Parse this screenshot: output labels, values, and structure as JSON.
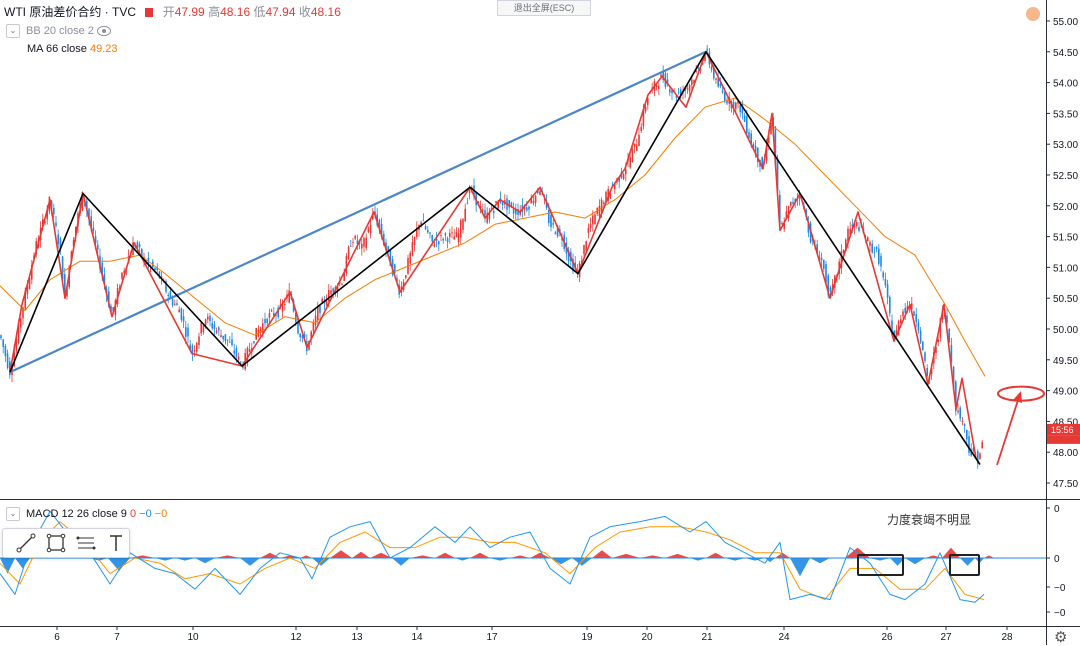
{
  "header": {
    "symbol": "WTI 原油差价合约 · TVC",
    "ohlc": [
      {
        "label": "开",
        "value": "47.99"
      },
      {
        "label": "高",
        "value": "48.16"
      },
      {
        "label": "低",
        "value": "47.94"
      },
      {
        "label": "收",
        "value": "48.16"
      }
    ],
    "esc_button": "退出全屏(ESC)"
  },
  "indicators": {
    "bb": "BB 20 close 2",
    "ma_label": "MA 66 close",
    "ma_value": "49.23",
    "macd_label": "MACD 12 26 close 9",
    "macd_values": [
      "0",
      "−0",
      "−0"
    ]
  },
  "annotation": "力度衰竭不明显",
  "colors": {
    "up": "#e53935",
    "down": "#1e88e5",
    "ma": "#f57c00",
    "trend_blue": "#4a86c8",
    "zigzag_black": "#000000",
    "zigzag_red": "#e53935",
    "macd_line": "#2196f3",
    "signal_line": "#ff9800"
  },
  "chart_data": [
    {
      "type": "line",
      "panel": "price",
      "ylim": [
        47.25,
        55.25
      ],
      "yticks": [
        "55.00",
        "54.50",
        "54.00",
        "53.50",
        "53.00",
        "52.50",
        "52.00",
        "51.50",
        "51.00",
        "50.50",
        "50.00",
        "49.50",
        "49.00",
        "48.50",
        "48.00",
        "47.50"
      ],
      "last_price_tag": "15:56",
      "x_labels": [
        {
          "label": "6",
          "t": 57
        },
        {
          "label": "7",
          "t": 117
        },
        {
          "label": "10",
          "t": 193
        },
        {
          "label": "12",
          "t": 296
        },
        {
          "label": "13",
          "t": 357
        },
        {
          "label": "14",
          "t": 417
        },
        {
          "label": "17",
          "t": 492
        },
        {
          "label": "19",
          "t": 587
        },
        {
          "label": "20",
          "t": 647
        },
        {
          "label": "21",
          "t": 707
        },
        {
          "label": "24",
          "t": 784
        },
        {
          "label": "26",
          "t": 887
        },
        {
          "label": "27",
          "t": 946
        },
        {
          "label": "28",
          "t": 1007
        }
      ],
      "price_path": [
        [
          0,
          49.9
        ],
        [
          10,
          49.3
        ],
        [
          22,
          50.3
        ],
        [
          35,
          51.3
        ],
        [
          50,
          52.1
        ],
        [
          60,
          51.3
        ],
        [
          65,
          50.5
        ],
        [
          72,
          51.4
        ],
        [
          83,
          52.2
        ],
        [
          95,
          51.4
        ],
        [
          112,
          50.2
        ],
        [
          122,
          50.9
        ],
        [
          134,
          51.4
        ],
        [
          145,
          51.1
        ],
        [
          158,
          50.9
        ],
        [
          170,
          50.5
        ],
        [
          180,
          50.3
        ],
        [
          192,
          49.6
        ],
        [
          205,
          50.2
        ],
        [
          215,
          50.0
        ],
        [
          228,
          49.8
        ],
        [
          242,
          49.4
        ],
        [
          255,
          49.9
        ],
        [
          268,
          50.2
        ],
        [
          280,
          50.3
        ],
        [
          290,
          50.6
        ],
        [
          298,
          50.0
        ],
        [
          307,
          49.7
        ],
        [
          318,
          50.3
        ],
        [
          330,
          50.6
        ],
        [
          342,
          50.8
        ],
        [
          352,
          51.5
        ],
        [
          362,
          51.3
        ],
        [
          374,
          51.9
        ],
        [
          386,
          51.3
        ],
        [
          400,
          50.6
        ],
        [
          412,
          51.3
        ],
        [
          420,
          51.8
        ],
        [
          432,
          51.4
        ],
        [
          445,
          51.5
        ],
        [
          458,
          51.5
        ],
        [
          470,
          52.3
        ],
        [
          485,
          51.8
        ],
        [
          500,
          52.1
        ],
        [
          515,
          51.9
        ],
        [
          528,
          52.0
        ],
        [
          540,
          52.3
        ],
        [
          550,
          51.7
        ],
        [
          562,
          51.5
        ],
        [
          570,
          51.1
        ],
        [
          578,
          50.9
        ],
        [
          588,
          51.6
        ],
        [
          600,
          52.0
        ],
        [
          612,
          52.3
        ],
        [
          625,
          52.6
        ],
        [
          636,
          53.0
        ],
        [
          648,
          53.8
        ],
        [
          662,
          54.1
        ],
        [
          675,
          53.8
        ],
        [
          686,
          53.9
        ],
        [
          698,
          54.2
        ],
        [
          706,
          54.5
        ],
        [
          716,
          54.0
        ],
        [
          728,
          53.7
        ],
        [
          740,
          53.6
        ],
        [
          752,
          53.0
        ],
        [
          763,
          52.6
        ],
        [
          772,
          53.5
        ],
        [
          780,
          51.6
        ],
        [
          790,
          52.0
        ],
        [
          800,
          52.2
        ],
        [
          812,
          51.4
        ],
        [
          822,
          51.1
        ],
        [
          830,
          50.5
        ],
        [
          840,
          51.1
        ],
        [
          848,
          51.6
        ],
        [
          858,
          51.7
        ],
        [
          868,
          51.4
        ],
        [
          878,
          51.2
        ],
        [
          886,
          50.6
        ],
        [
          894,
          49.8
        ],
        [
          902,
          50.3
        ],
        [
          910,
          50.4
        ],
        [
          918,
          50.1
        ],
        [
          928,
          49.1
        ],
        [
          938,
          49.9
        ],
        [
          944,
          50.4
        ],
        [
          950,
          49.7
        ],
        [
          956,
          48.7
        ],
        [
          963,
          48.5
        ],
        [
          970,
          48.0
        ],
        [
          978,
          47.9
        ],
        [
          984,
          48.2
        ]
      ],
      "ma_path": [
        [
          0,
          50.7
        ],
        [
          25,
          50.3
        ],
        [
          50,
          50.8
        ],
        [
          80,
          51.1
        ],
        [
          110,
          51.1
        ],
        [
          140,
          51.2
        ],
        [
          165,
          50.9
        ],
        [
          195,
          50.5
        ],
        [
          225,
          50.1
        ],
        [
          255,
          49.9
        ],
        [
          285,
          50.2
        ],
        [
          315,
          50.1
        ],
        [
          345,
          50.5
        ],
        [
          375,
          50.8
        ],
        [
          405,
          51.0
        ],
        [
          435,
          51.2
        ],
        [
          465,
          51.4
        ],
        [
          495,
          51.7
        ],
        [
          525,
          51.8
        ],
        [
          555,
          51.9
        ],
        [
          585,
          51.8
        ],
        [
          615,
          52.1
        ],
        [
          645,
          52.5
        ],
        [
          675,
          53.1
        ],
        [
          705,
          53.6
        ],
        [
          735,
          53.75
        ],
        [
          765,
          53.4
        ],
        [
          795,
          53.0
        ],
        [
          825,
          52.5
        ],
        [
          855,
          52.0
        ],
        [
          885,
          51.5
        ],
        [
          915,
          51.2
        ],
        [
          945,
          50.4
        ],
        [
          965,
          49.8
        ],
        [
          985,
          49.23
        ]
      ],
      "blue_trendline": [
        [
          10,
          49.3
        ],
        [
          706,
          54.5
        ]
      ],
      "black_zigzag": [
        [
          10,
          49.3
        ],
        [
          83,
          52.2
        ],
        [
          242,
          49.4
        ],
        [
          470,
          52.3
        ],
        [
          578,
          50.9
        ],
        [
          706,
          54.5
        ],
        [
          980,
          47.8
        ]
      ],
      "red_zigzag": [
        [
          10,
          49.3
        ],
        [
          22,
          50.4
        ],
        [
          50,
          52.1
        ],
        [
          65,
          50.5
        ],
        [
          83,
          52.2
        ],
        [
          112,
          50.2
        ],
        [
          134,
          51.4
        ],
        [
          192,
          49.6
        ],
        [
          242,
          49.4
        ],
        [
          290,
          50.6
        ],
        [
          307,
          49.7
        ],
        [
          374,
          51.9
        ],
        [
          400,
          50.6
        ],
        [
          470,
          52.3
        ],
        [
          485,
          51.8
        ],
        [
          500,
          52.1
        ],
        [
          520,
          51.9
        ],
        [
          540,
          52.3
        ],
        [
          578,
          50.9
        ],
        [
          612,
          52.3
        ],
        [
          625,
          52.6
        ],
        [
          648,
          53.8
        ],
        [
          662,
          54.1
        ],
        [
          686,
          53.6
        ],
        [
          706,
          54.5
        ],
        [
          763,
          52.6
        ],
        [
          772,
          53.5
        ],
        [
          780,
          51.6
        ],
        [
          800,
          52.2
        ],
        [
          830,
          50.5
        ],
        [
          858,
          51.9
        ],
        [
          894,
          49.8
        ],
        [
          910,
          50.4
        ],
        [
          928,
          49.1
        ],
        [
          944,
          50.4
        ],
        [
          956,
          48.7
        ],
        [
          962,
          49.2
        ],
        [
          976,
          47.9
        ]
      ],
      "circle_marker": {
        "t": 1021,
        "price": 48.95
      }
    },
    {
      "type": "line",
      "panel": "macd",
      "ylim": [
        -1.0,
        1.0
      ],
      "yticks": [
        "0",
        "0",
        "−0",
        "−0"
      ],
      "macd_line": [
        [
          0,
          -0.3
        ],
        [
          15,
          -0.7
        ],
        [
          30,
          0.2
        ],
        [
          50,
          0.9
        ],
        [
          70,
          0.4
        ],
        [
          90,
          0.1
        ],
        [
          110,
          -0.5
        ],
        [
          130,
          0.1
        ],
        [
          155,
          -0.2
        ],
        [
          175,
          -0.3
        ],
        [
          195,
          -0.6
        ],
        [
          215,
          -0.2
        ],
        [
          240,
          -0.7
        ],
        [
          260,
          -0.2
        ],
        [
          280,
          0.1
        ],
        [
          300,
          0.0
        ],
        [
          312,
          -0.4
        ],
        [
          330,
          0.4
        ],
        [
          350,
          0.6
        ],
        [
          370,
          0.7
        ],
        [
          390,
          0.0
        ],
        [
          410,
          0.2
        ],
        [
          435,
          0.6
        ],
        [
          455,
          0.3
        ],
        [
          470,
          0.6
        ],
        [
          490,
          0.2
        ],
        [
          510,
          0.4
        ],
        [
          530,
          0.5
        ],
        [
          550,
          -0.2
        ],
        [
          570,
          -0.5
        ],
        [
          590,
          0.4
        ],
        [
          610,
          0.6
        ],
        [
          640,
          0.7
        ],
        [
          665,
          0.8
        ],
        [
          690,
          0.5
        ],
        [
          706,
          0.7
        ],
        [
          725,
          0.3
        ],
        [
          745,
          0.1
        ],
        [
          765,
          -0.1
        ],
        [
          780,
          0.3
        ],
        [
          790,
          -0.8
        ],
        [
          810,
          -0.7
        ],
        [
          830,
          -0.8
        ],
        [
          850,
          0.2
        ],
        [
          870,
          -0.1
        ],
        [
          890,
          -0.7
        ],
        [
          905,
          -0.8
        ],
        [
          925,
          -0.5
        ],
        [
          940,
          0.1
        ],
        [
          960,
          -0.8
        ],
        [
          975,
          -0.85
        ],
        [
          984,
          -0.7
        ]
      ],
      "signal_line": [
        [
          0,
          -0.1
        ],
        [
          20,
          -0.5
        ],
        [
          40,
          0.3
        ],
        [
          60,
          0.7
        ],
        [
          85,
          0.3
        ],
        [
          110,
          -0.3
        ],
        [
          135,
          0.0
        ],
        [
          160,
          -0.1
        ],
        [
          185,
          -0.4
        ],
        [
          210,
          -0.3
        ],
        [
          240,
          -0.5
        ],
        [
          265,
          -0.2
        ],
        [
          290,
          0.0
        ],
        [
          315,
          -0.2
        ],
        [
          340,
          0.3
        ],
        [
          365,
          0.5
        ],
        [
          390,
          0.2
        ],
        [
          415,
          0.2
        ],
        [
          440,
          0.4
        ],
        [
          465,
          0.4
        ],
        [
          490,
          0.3
        ],
        [
          515,
          0.3
        ],
        [
          545,
          0.1
        ],
        [
          570,
          -0.3
        ],
        [
          595,
          0.2
        ],
        [
          620,
          0.5
        ],
        [
          650,
          0.6
        ],
        [
          680,
          0.6
        ],
        [
          706,
          0.5
        ],
        [
          730,
          0.35
        ],
        [
          755,
          0.1
        ],
        [
          780,
          0.1
        ],
        [
          800,
          -0.6
        ],
        [
          825,
          -0.8
        ],
        [
          850,
          -0.2
        ],
        [
          875,
          -0.2
        ],
        [
          900,
          -0.6
        ],
        [
          925,
          -0.6
        ],
        [
          945,
          -0.2
        ],
        [
          965,
          -0.7
        ],
        [
          984,
          -0.8
        ]
      ],
      "histogram": [
        [
          0,
          -0.3
        ],
        [
          15,
          -0.2
        ],
        [
          30,
          0.05
        ],
        [
          50,
          0.2
        ],
        [
          70,
          0.1
        ],
        [
          90,
          -0.05
        ],
        [
          108,
          -0.25
        ],
        [
          130,
          0.05
        ],
        [
          155,
          -0.05
        ],
        [
          175,
          -0.05
        ],
        [
          195,
          -0.1
        ],
        [
          215,
          0.05
        ],
        [
          240,
          -0.15
        ],
        [
          260,
          0.1
        ],
        [
          280,
          0.05
        ],
        [
          300,
          0.05
        ],
        [
          312,
          -0.15
        ],
        [
          330,
          0.15
        ],
        [
          352,
          0.12
        ],
        [
          370,
          0.1
        ],
        [
          392,
          -0.15
        ],
        [
          410,
          0.05
        ],
        [
          435,
          0.1
        ],
        [
          455,
          -0.05
        ],
        [
          470,
          0.1
        ],
        [
          490,
          -0.05
        ],
        [
          510,
          0.05
        ],
        [
          530,
          0.1
        ],
        [
          550,
          -0.12
        ],
        [
          572,
          -0.15
        ],
        [
          592,
          0.15
        ],
        [
          612,
          0.08
        ],
        [
          640,
          0.05
        ],
        [
          665,
          0.08
        ],
        [
          690,
          -0.05
        ],
        [
          706,
          0.1
        ],
        [
          725,
          -0.05
        ],
        [
          745,
          -0.05
        ],
        [
          765,
          -0.08
        ],
        [
          775,
          0.1
        ],
        [
          790,
          -0.35
        ],
        [
          810,
          -0.1
        ],
        [
          830,
          0.0
        ],
        [
          845,
          0.2
        ],
        [
          870,
          -0.05
        ],
        [
          890,
          -0.15
        ],
        [
          905,
          -0.12
        ],
        [
          925,
          0.05
        ],
        [
          942,
          0.2
        ],
        [
          960,
          -0.15
        ],
        [
          975,
          -0.1
        ],
        [
          984,
          0.05
        ]
      ],
      "highlight_boxes": [
        [
          858,
          903
        ],
        [
          950,
          979
        ]
      ]
    }
  ]
}
